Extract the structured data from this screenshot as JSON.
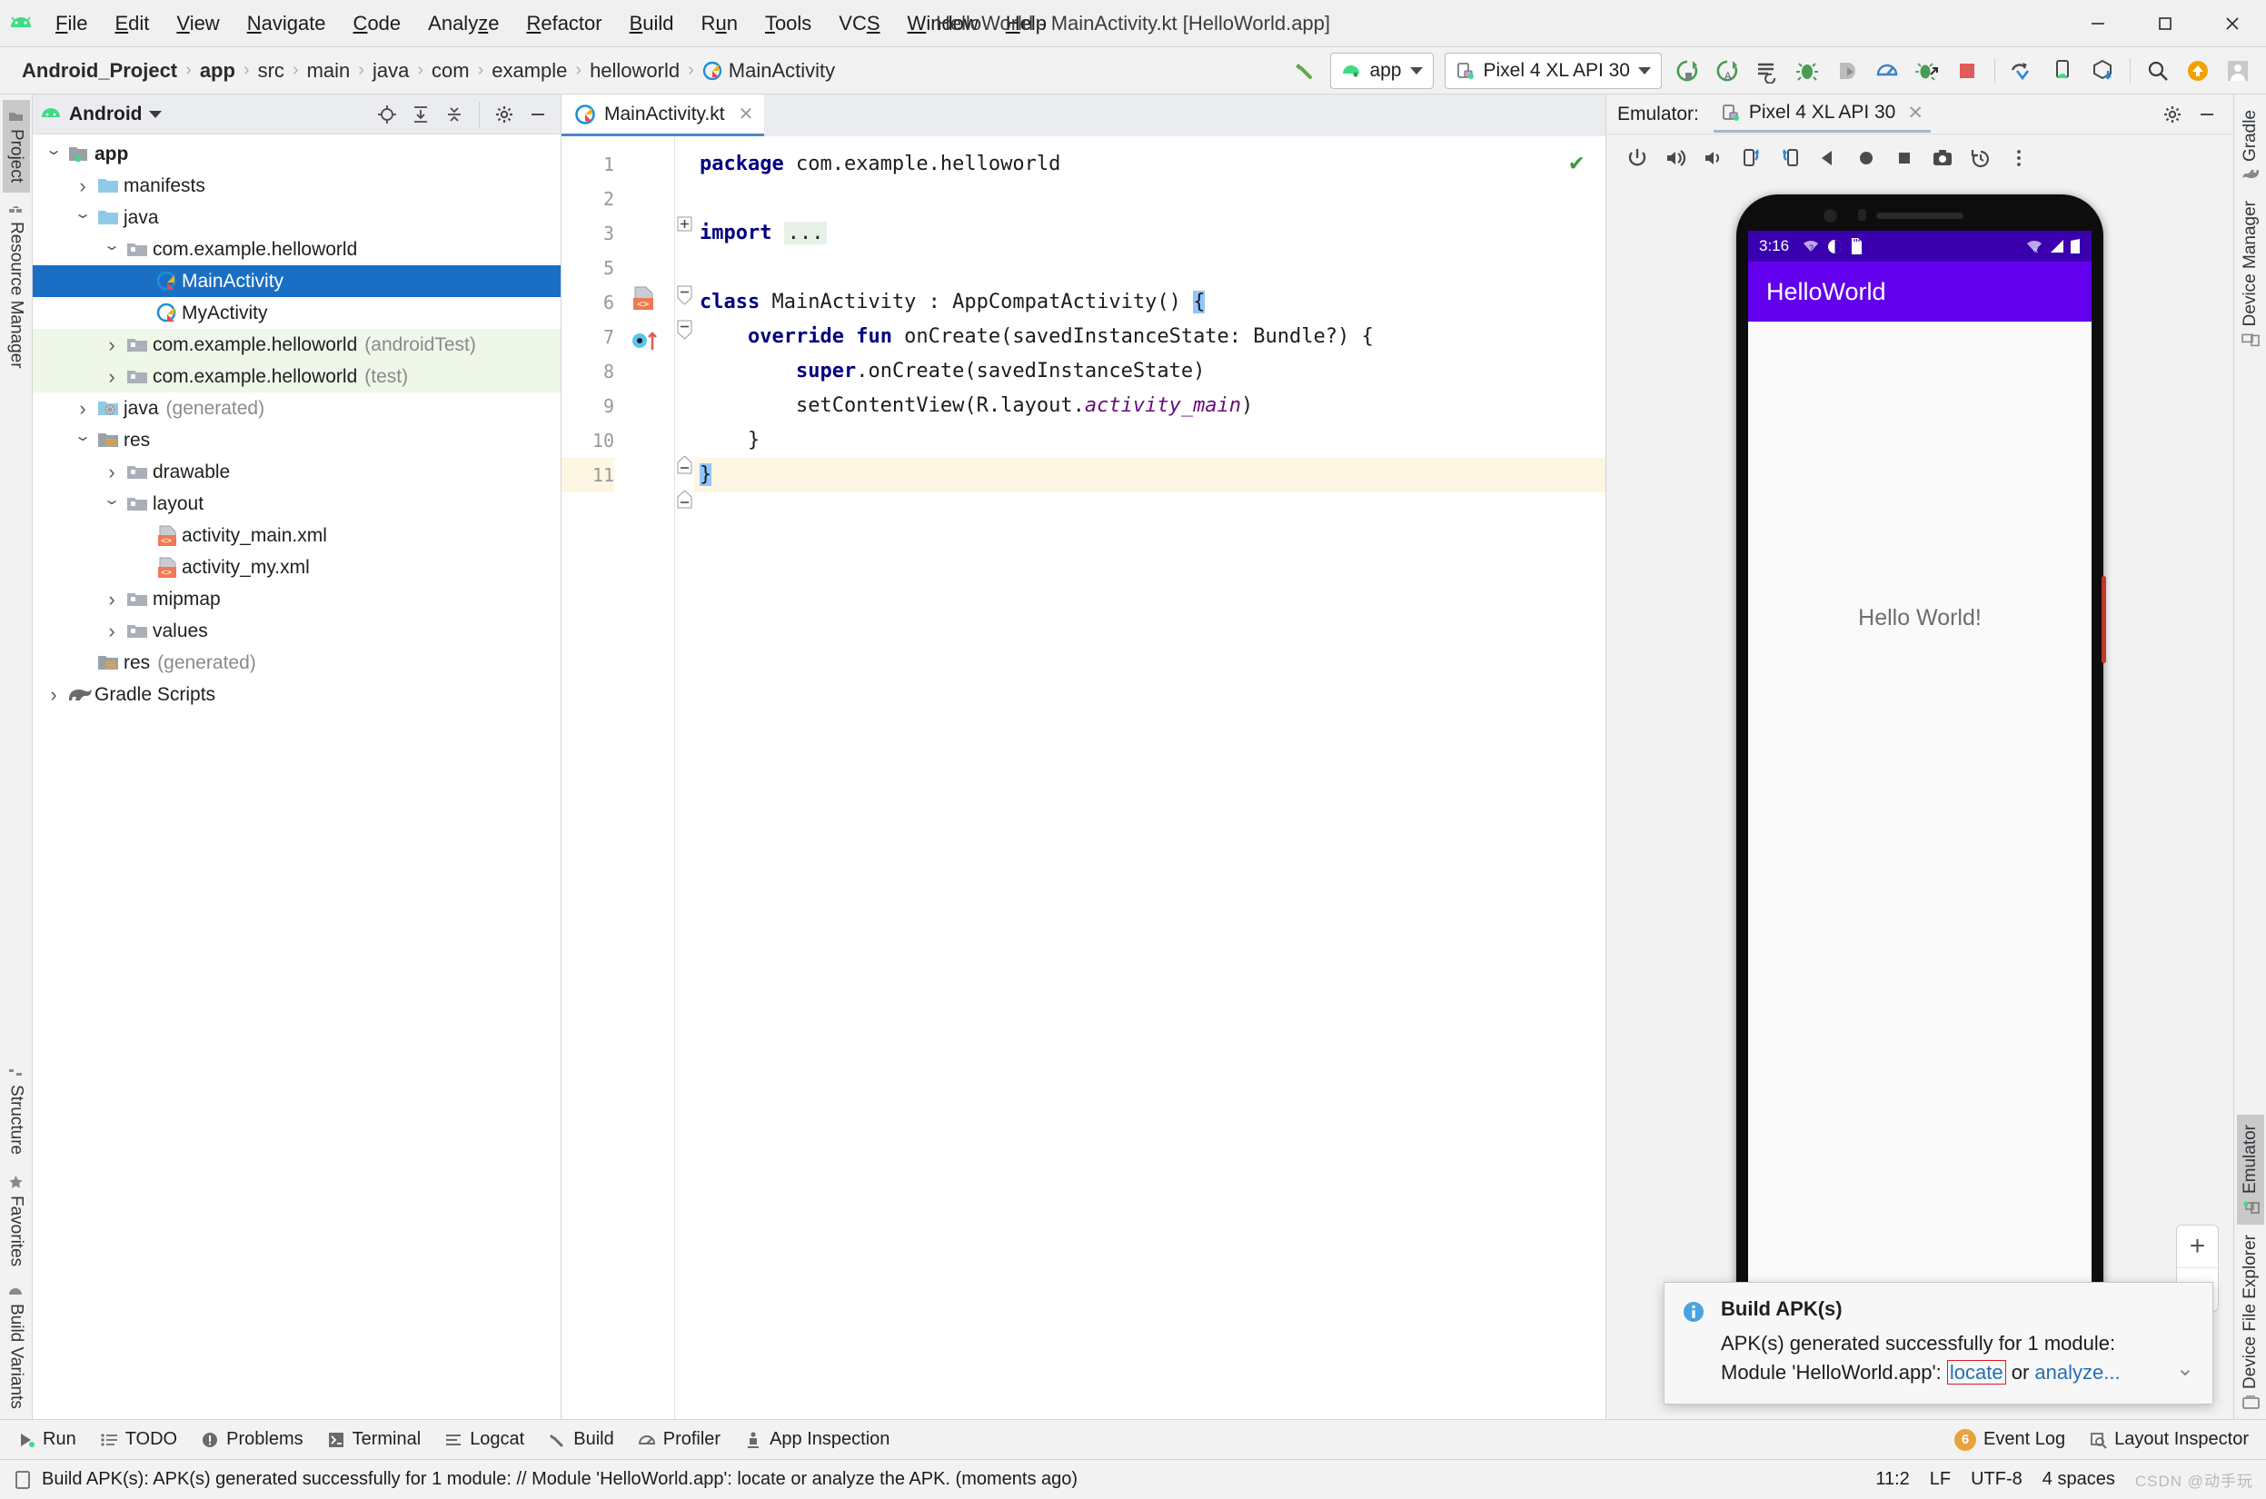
{
  "window": {
    "title": "HelloWorld - MainActivity.kt [HelloWorld.app]",
    "minimize": "—",
    "maximize": "□",
    "close": "✕"
  },
  "menubar": {
    "items": [
      {
        "label": "File",
        "mnemonic": "F"
      },
      {
        "label": "Edit",
        "mnemonic": "E"
      },
      {
        "label": "View",
        "mnemonic": "V"
      },
      {
        "label": "Navigate",
        "mnemonic": "N"
      },
      {
        "label": "Code",
        "mnemonic": "C"
      },
      {
        "label": "Analyze",
        "mnemonic": "z"
      },
      {
        "label": "Refactor",
        "mnemonic": "R"
      },
      {
        "label": "Build",
        "mnemonic": "B"
      },
      {
        "label": "Run",
        "mnemonic": "u"
      },
      {
        "label": "Tools",
        "mnemonic": "T"
      },
      {
        "label": "VCS",
        "mnemonic": "S"
      },
      {
        "label": "Window",
        "mnemonic": "W"
      },
      {
        "label": "Help",
        "mnemonic": "H"
      }
    ]
  },
  "breadcrumb": {
    "items": [
      "Android_Project",
      "app",
      "src",
      "main",
      "java",
      "com",
      "example",
      "helloworld",
      "MainActivity"
    ],
    "separator": "›"
  },
  "toolbar": {
    "build_hammer": "build-hammer-icon",
    "run_config": "app",
    "device": "Pixel 4 XL API 30",
    "icons": [
      "run-icon",
      "run-apply-changes-icon",
      "apply-code-changes-icon",
      "debug-icon",
      "attach-debugger-icon",
      "profiler-icon",
      "debug-attach-icon",
      "stop-icon",
      "sync-gradle-icon",
      "avd-manager-icon",
      "sdk-manager-icon",
      "search-icon",
      "update-icon",
      "account-icon"
    ]
  },
  "left_rail": {
    "items": [
      {
        "label": "Project",
        "icon": "project-icon",
        "selected": true
      },
      {
        "label": "Resource Manager",
        "icon": "resource-manager-icon",
        "selected": false
      },
      {
        "label": "Structure",
        "icon": "structure-icon",
        "selected": false
      },
      {
        "label": "Favorites",
        "icon": "star-icon",
        "selected": false
      },
      {
        "label": "Build Variants",
        "icon": "build-variants-icon",
        "selected": false
      }
    ]
  },
  "right_rail": {
    "items": [
      {
        "label": "Gradle",
        "icon": "gradle-elephant-icon",
        "selected": false
      },
      {
        "label": "Device Manager",
        "icon": "device-manager-icon",
        "selected": false
      },
      {
        "label": "Emulator",
        "icon": "emulator-icon",
        "selected": true
      },
      {
        "label": "Device File Explorer",
        "icon": "device-file-explorer-icon",
        "selected": false
      }
    ]
  },
  "project_panel": {
    "title": "Android",
    "header_icons": [
      "locate-icon",
      "expand-all-icon",
      "collapse-all-icon",
      "settings-gear-icon",
      "hide-icon"
    ],
    "tree": [
      {
        "label": "app",
        "indent": 0,
        "arrow": "down",
        "icon": "module-folder-icon",
        "bold": true,
        "sub": "",
        "state": "normal"
      },
      {
        "label": "manifests",
        "indent": 1,
        "arrow": "right",
        "icon": "folder-blue-icon",
        "bold": false,
        "sub": "",
        "state": "normal"
      },
      {
        "label": "java",
        "indent": 1,
        "arrow": "down",
        "icon": "folder-blue-icon",
        "bold": false,
        "sub": "",
        "state": "normal"
      },
      {
        "label": "com.example.helloworld",
        "indent": 2,
        "arrow": "down",
        "icon": "package-icon",
        "bold": false,
        "sub": "",
        "state": "normal"
      },
      {
        "label": "MainActivity",
        "indent": 3,
        "arrow": "none",
        "icon": "kotlin-class-icon",
        "bold": false,
        "sub": "",
        "state": "selected"
      },
      {
        "label": "MyActivity",
        "indent": 3,
        "arrow": "none",
        "icon": "kotlin-class-icon",
        "bold": false,
        "sub": "",
        "state": "normal"
      },
      {
        "label": "com.example.helloworld",
        "indent": 2,
        "arrow": "right",
        "icon": "package-icon",
        "bold": false,
        "sub": "(androidTest)",
        "state": "testsrc"
      },
      {
        "label": "com.example.helloworld",
        "indent": 2,
        "arrow": "right",
        "icon": "package-icon",
        "bold": false,
        "sub": "(test)",
        "state": "testsrc"
      },
      {
        "label": "java",
        "indent": 1,
        "arrow": "right",
        "icon": "folder-generated-icon",
        "bold": false,
        "sub": "(generated)",
        "state": "normal"
      },
      {
        "label": "res",
        "indent": 1,
        "arrow": "down",
        "icon": "folder-res-icon",
        "bold": false,
        "sub": "",
        "state": "normal"
      },
      {
        "label": "drawable",
        "indent": 2,
        "arrow": "right",
        "icon": "package-icon",
        "bold": false,
        "sub": "",
        "state": "normal"
      },
      {
        "label": "layout",
        "indent": 2,
        "arrow": "down",
        "icon": "package-icon",
        "bold": false,
        "sub": "",
        "state": "normal"
      },
      {
        "label": "activity_main.xml",
        "indent": 3,
        "arrow": "none",
        "icon": "xml-layout-icon",
        "bold": false,
        "sub": "",
        "state": "normal"
      },
      {
        "label": "activity_my.xml",
        "indent": 3,
        "arrow": "none",
        "icon": "xml-layout-icon",
        "bold": false,
        "sub": "",
        "state": "normal"
      },
      {
        "label": "mipmap",
        "indent": 2,
        "arrow": "right",
        "icon": "package-icon",
        "bold": false,
        "sub": "",
        "state": "normal"
      },
      {
        "label": "values",
        "indent": 2,
        "arrow": "right",
        "icon": "package-icon",
        "bold": false,
        "sub": "",
        "state": "normal"
      },
      {
        "label": "res",
        "indent": 1,
        "arrow": "none",
        "icon": "folder-res-icon",
        "bold": false,
        "sub": "(generated)",
        "state": "normal"
      },
      {
        "label": "Gradle Scripts",
        "indent": 0,
        "arrow": "right",
        "icon": "gradle-elephant-icon",
        "bold": false,
        "sub": "",
        "state": "normal"
      }
    ]
  },
  "editor": {
    "tab": {
      "label": "MainActivity.kt",
      "icon": "kotlin-file-icon",
      "close": "✕"
    },
    "inspection_status": "✔",
    "line_numbers": [
      "1",
      "2",
      "3",
      "5",
      "6",
      "7",
      "8",
      "9",
      "10",
      "11"
    ],
    "lines": [
      "package com.example.helloworld",
      "",
      "import ...",
      "",
      "class MainActivity : AppCompatActivity() {",
      "    override fun onCreate(savedInstanceState: Bundle?) {",
      "        super.onCreate(savedInstanceState)",
      "        setContentView(R.layout.activity_main)",
      "    }",
      "}"
    ],
    "tokens": {
      "t1_kw": "package",
      "t1_rest": " com.example.helloworld",
      "t3_kw": "import",
      "t3_fold": "...",
      "t5_kw": "class",
      "t5_rest": " MainActivity : AppCompatActivity() ",
      "t5_brace": "{",
      "t6_ind": "    ",
      "t6_kw1": "override",
      "t6_kw2": " fun",
      "t6_rest": " onCreate(savedInstanceState: Bundle?) {",
      "t7_ind": "        ",
      "t7_kw": "super",
      "t7_rest": ".onCreate(savedInstanceState)",
      "t8_ind": "        ",
      "t8_a": "setContentView(R.layout.",
      "t8_attr": "activity_main",
      "t8_b": ")",
      "t9": "    }",
      "t10_brace": "}"
    }
  },
  "emulator": {
    "label": "Emulator:",
    "tab": "Pixel 4 XL API 30",
    "tab_close": "✕",
    "header_icons": [
      "settings-gear-icon",
      "hide-icon"
    ],
    "toolbar_icons": [
      "power-icon",
      "volume-up-icon",
      "volume-down-icon",
      "rotate-left-icon",
      "rotate-right-icon",
      "back-icon",
      "home-icon",
      "overview-icon",
      "screenshot-icon",
      "history-icon",
      "more-vertical-icon"
    ],
    "zoom_in": "+",
    "zoom_out": "−",
    "device": {
      "status_time": "3:16",
      "status_icons": [
        "wifi-question-icon",
        "cast-icon",
        "sd-card-icon"
      ],
      "status_icons_right": [
        "wifi-off-icon",
        "signal-icon",
        "battery-icon"
      ],
      "app_title": "HelloWorld",
      "content_text": "Hello World!",
      "appbar_color": "#6200ee",
      "statusbar_color": "#3a00b0"
    }
  },
  "balloon": {
    "icon": "info-icon",
    "title": "Build APK(s)",
    "line1": "APK(s) generated successfully for 1 module:",
    "line2_prefix": "Module 'HelloWorld.app': ",
    "link_locate": "locate",
    "line2_mid": " or ",
    "link_analyze": "analyze...",
    "chevron": "⌄"
  },
  "tool_window_bar": {
    "items": [
      {
        "label": "Run",
        "icon": "run-icon"
      },
      {
        "label": "TODO",
        "icon": "todo-icon"
      },
      {
        "label": "Problems",
        "icon": "problems-icon"
      },
      {
        "label": "Terminal",
        "icon": "terminal-icon"
      },
      {
        "label": "Logcat",
        "icon": "logcat-icon"
      },
      {
        "label": "Build",
        "icon": "build-hammer-icon"
      },
      {
        "label": "Profiler",
        "icon": "profiler-icon"
      },
      {
        "label": "App Inspection",
        "icon": "app-inspection-icon"
      }
    ],
    "right_items": [
      {
        "label": "Event Log",
        "icon": "event-log-icon",
        "badge": "6"
      },
      {
        "label": "Layout Inspector",
        "icon": "layout-inspector-icon",
        "badge": ""
      }
    ]
  },
  "status_bar": {
    "icon": "status-message-icon",
    "message": "Build APK(s): APK(s) generated successfully for 1 module: // Module 'HelloWorld.app': locate or analyze the APK. (moments ago)",
    "caret": "11:2",
    "line_sep": "LF",
    "encoding": "UTF-8",
    "indent": "4 spaces",
    "watermark": "CSDN @动手玩"
  }
}
